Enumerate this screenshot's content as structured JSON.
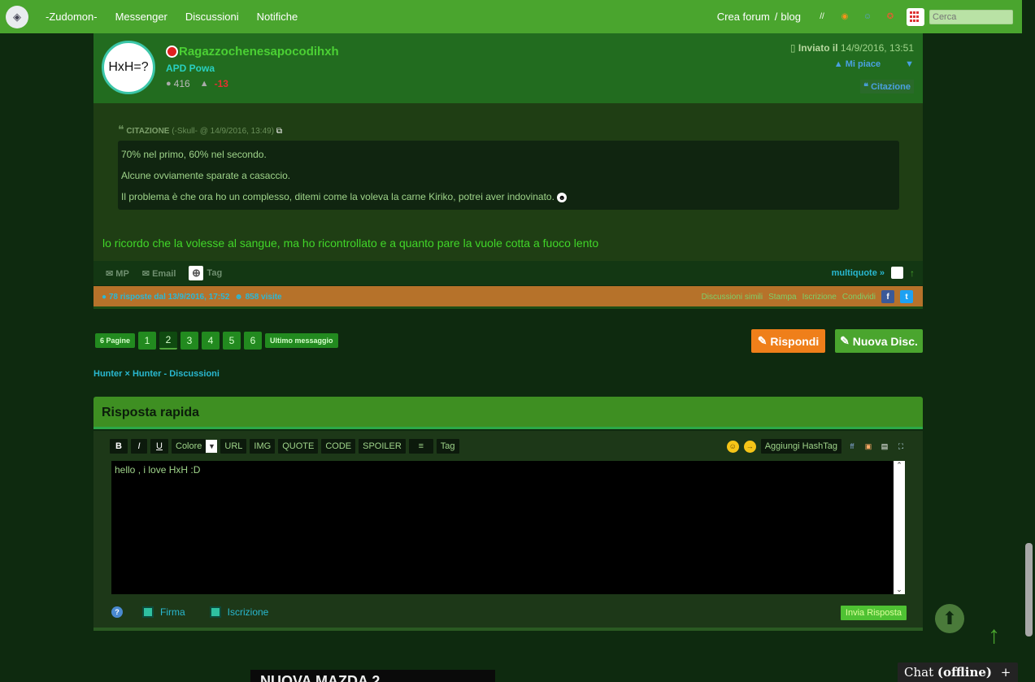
{
  "nav": {
    "items": [
      "-Zudomon-",
      "Messenger",
      "Discussioni",
      "Notifiche"
    ],
    "right_links": [
      "Crea forum",
      "blog"
    ],
    "search_placeholder": "Cerca"
  },
  "post": {
    "avatar_text": "HxH=?",
    "username": "Ragazzochenesapocodihxh",
    "group": "APD Powa",
    "posts_count": "416",
    "rep": "-13",
    "sent_label": "Inviato il",
    "sent_date": "14/9/2016, 13:51",
    "like_label": "Mi piace",
    "quote_button": "Citazione",
    "quote_header": "CITAZIONE",
    "quote_meta": "(-Skull- @ 14/9/2016, 13:49)",
    "quote_lines": [
      "70% nel primo, 60% nel secondo.",
      "Alcune ovviamente sparate a casaccio.",
      "Il problema è che ora ho un complesso, ditemi come la voleva la carne Kiriko, potrei aver indovinato."
    ],
    "reply_text": "lo ricordo che la volesse al sangue, ma ho ricontrollato e a quanto pare la vuole cotta a fuoco lento",
    "footer": {
      "mp": "MP",
      "email": "Email",
      "tag": "Tag",
      "multiquote": "multiquote »"
    }
  },
  "info_bar": {
    "replies": "78 risposte dal 13/9/2016, 17:52",
    "visits": "858 visite",
    "links": [
      "Discussioni simili",
      "Stampa",
      "Iscrizione",
      "Condividi"
    ]
  },
  "pager": {
    "pages_label": "6 Pagine",
    "pages": [
      "1",
      "2",
      "3",
      "4",
      "5",
      "6"
    ],
    "current": "2",
    "last": "Ultimo messaggio"
  },
  "actions": {
    "reply": "Rispondi",
    "new_thread": "Nuova Disc."
  },
  "breadcrumb": "Hunter × Hunter - Discussioni",
  "quick_reply": {
    "title": "Risposta rapida",
    "toolbar": [
      "B",
      "I",
      "U",
      "Colore",
      "URL",
      "IMG",
      "QUOTE",
      "CODE",
      "SPOILER",
      "Tag"
    ],
    "hashtag": "Aggiungi HashTag",
    "text": "hello ,  i love HxH  :D",
    "firma": "Firma",
    "iscrizione": "Iscrizione",
    "send": "Invia Risposta"
  },
  "chat": {
    "label": "Chat",
    "status": "(offline)"
  },
  "ad_text": "NUOVA MAZDA 2",
  "colors": {
    "topbar": "#4aa52e",
    "reply_button": "#ef7f1a",
    "accent_text": "#41d629",
    "link": "#29b8d0"
  }
}
